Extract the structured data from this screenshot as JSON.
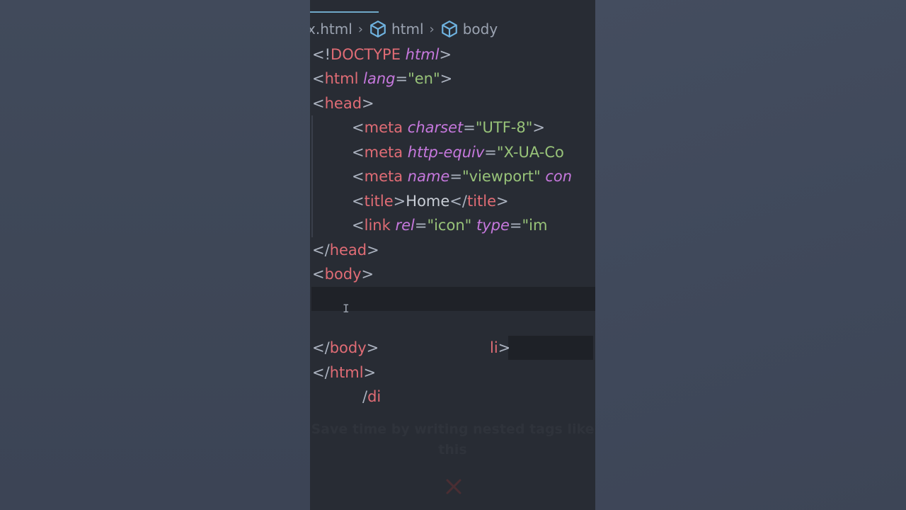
{
  "breadcrumb": {
    "file": "x.html",
    "items": [
      "html",
      "body"
    ],
    "icon": "cube-icon"
  },
  "code_lines": [
    {
      "text": "<!DOCTYPE html>"
    },
    {
      "text": "<html lang=\"en\">"
    },
    {
      "text": "<head>"
    },
    {
      "text": "<meta charset=\"UTF-8\">"
    },
    {
      "text": "<meta http-equiv=\"X-UA-Co"
    },
    {
      "text": "<meta name=\"viewport\" con"
    },
    {
      "text": "<title>Home</title>"
    },
    {
      "text": "<link rel=\"icon\" type=\"im"
    },
    {
      "text": "</head>"
    },
    {
      "text": "<body>"
    },
    {
      "text": ""
    },
    {
      "text": ""
    },
    {
      "text": "</body>"
    },
    {
      "text": "</html>"
    },
    {
      "text": "/di"
    }
  ],
  "partial_text": {
    "li_fragment": "li>"
  },
  "caption": "Save time by writing nested tags like this",
  "colors": {
    "editor_bg": "#282c34",
    "tag": "#e06c75",
    "attribute": "#c678dd",
    "string": "#98c379",
    "punctuation": "#abb2bf",
    "background": "#3e4757"
  }
}
